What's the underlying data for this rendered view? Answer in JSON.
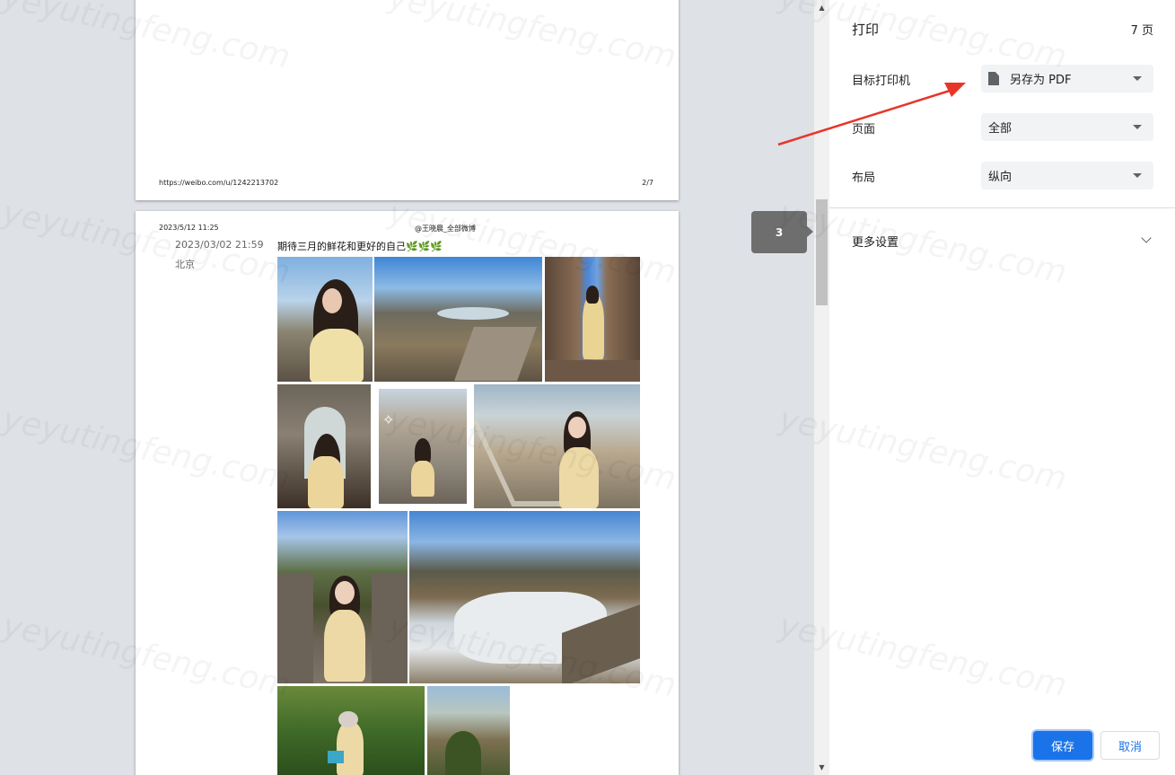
{
  "preview": {
    "page_prev": {
      "footer_url": "https://weibo.com/u/1242213702",
      "footer_page": "2/7"
    },
    "page_current": {
      "header_date": "2023/5/12 11:25",
      "header_title": "@王晓晨_全部微博",
      "post_time": "2023/03/02 21:59",
      "post_location": "北京",
      "post_text": "期待三月的鲜花和更好的自己",
      "post_emoji": "🌿🌿🌿"
    },
    "page_bubble": "3"
  },
  "sidebar": {
    "title": "打印",
    "page_count": "7 页",
    "printer_label": "目标打印机",
    "printer_value": "另存为 PDF",
    "pages_label": "页面",
    "pages_value": "全部",
    "layout_label": "布局",
    "layout_value": "纵向",
    "more_settings": "更多设置",
    "save_label": "保存",
    "cancel_label": "取消"
  },
  "watermark": "yeyutingfeng.com",
  "colors": {
    "accent": "#1a73e8",
    "annotation_arrow": "#e8352a"
  },
  "icons": [
    "document-icon",
    "chevron-down-icon",
    "caret-down-icon",
    "scroll-up-icon",
    "scroll-down-icon"
  ]
}
